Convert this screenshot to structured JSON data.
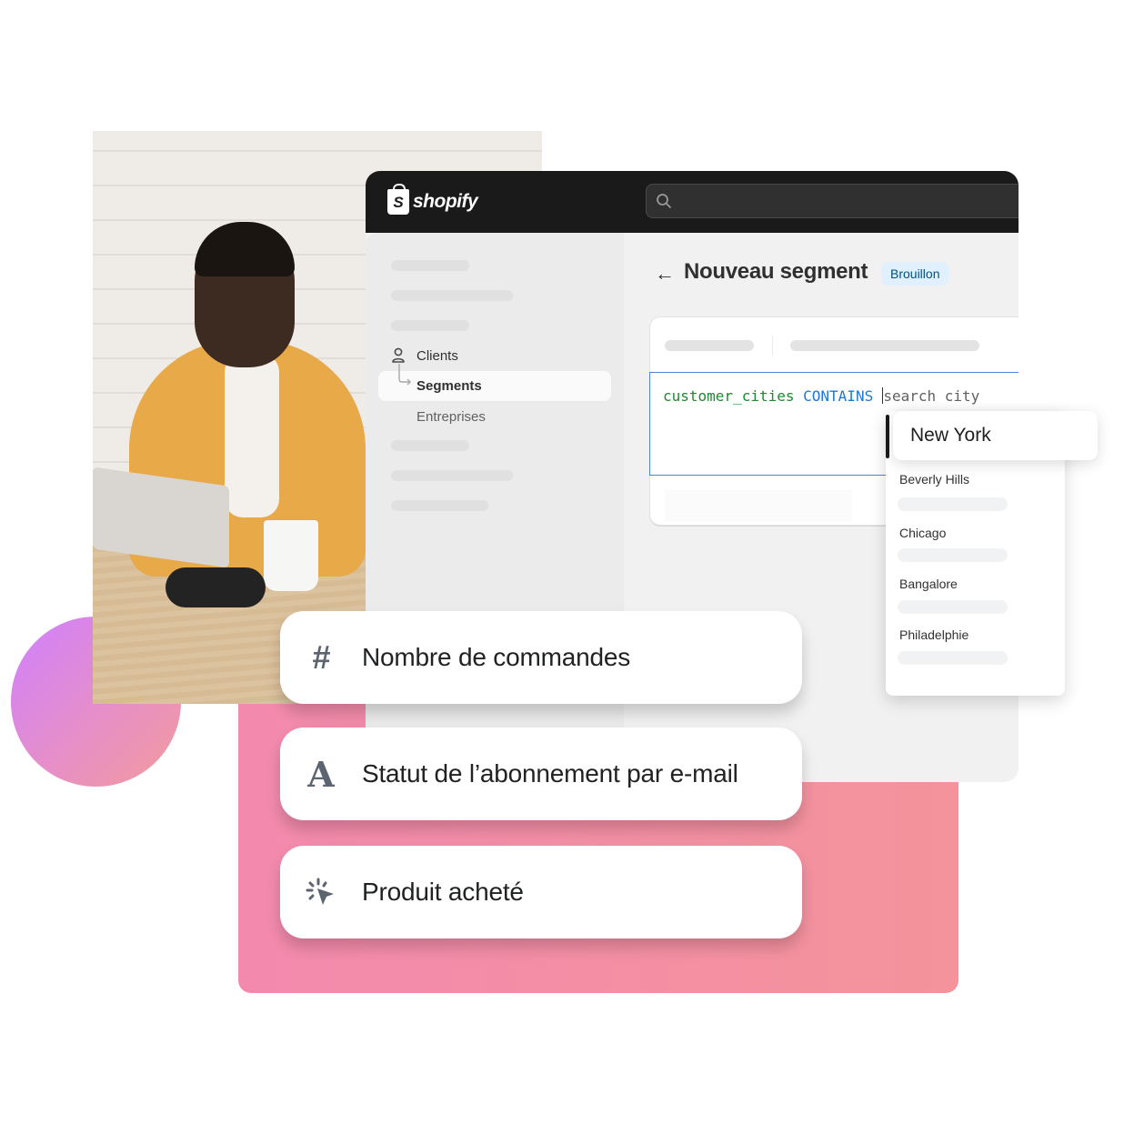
{
  "colors": {
    "accent_blue": "#4a86d8",
    "code_field": "#1f8a30",
    "code_operator": "#1d78d6",
    "badge_bg": "#e0f0ff",
    "badge_text": "#00527c",
    "pink": "#f38aae",
    "topbar": "#1a1a1a"
  },
  "brand": {
    "logo_letter": "S",
    "name": "shopify",
    "logo_icon": "shopify-bag-icon"
  },
  "search": {
    "icon": "search-icon",
    "placeholder": ""
  },
  "sidebar": {
    "items": [
      {
        "label": "Clients",
        "icon": "person-icon",
        "active": false
      },
      {
        "label": "Segments",
        "icon": "subitem-arrow-icon",
        "active": true
      },
      {
        "label": "Entreprises",
        "active": false
      }
    ]
  },
  "main": {
    "back_icon": "arrow-left-icon",
    "title": "Nouveau segment",
    "badge": "Brouillon",
    "editor": {
      "field": "customer_cities",
      "operator": "CONTAINS",
      "placeholder": "search city"
    }
  },
  "dropdown": {
    "selected": "New York",
    "options": [
      "Beverly Hills",
      "Chicago",
      "Bangalore",
      "Philadelphie"
    ]
  },
  "features": [
    {
      "icon": "hash-icon",
      "glyph": "#",
      "label": "Nombre de commandes"
    },
    {
      "icon": "text-a-icon",
      "glyph": "A",
      "label": "Statut de l’abonnement par e-mail"
    },
    {
      "icon": "cursor-click-icon",
      "glyph": "",
      "label": "Produit acheté"
    }
  ]
}
